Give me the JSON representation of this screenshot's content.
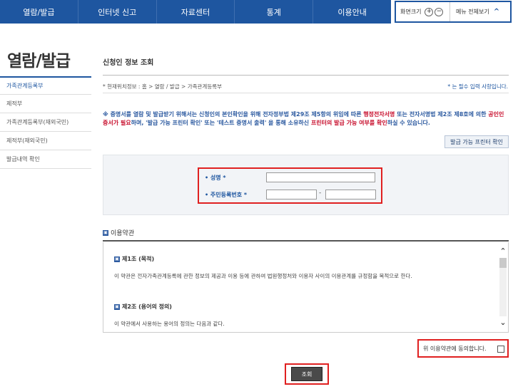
{
  "nav": {
    "items": [
      "열람/발급",
      "인터넷 신고",
      "자료센터",
      "통계",
      "이용안내"
    ],
    "zoom_label": "화면크기",
    "zoom_in": "+",
    "zoom_out": "−",
    "all_menu": "메뉴 전체보기",
    "chevron": "^"
  },
  "sidebar": {
    "title": "열람/발급",
    "items": [
      "가족관계등록부",
      "제적부",
      "가족관계등록부(재외국민)",
      "제적부(재외국민)",
      "발급내역 확인"
    ]
  },
  "main": {
    "title": "신청인 정보 조회",
    "breadcrumb": "* 현재위치정보 : 홈 > 열람 / 발급 > 가족관계등록부",
    "required_note": "* 는 필수 입력 사항입니다.",
    "notice": {
      "p1": "※ 증명서를 열람 및 발급받기 위해서는 신청인의 본인확인을 위해 전자정부법 제29조 제5항의 위임에 따른 ",
      "p2": "행정전자서명",
      "p3": " 또는 전자서명법 제2조 제8호에 의한 ",
      "p4": "공인인증서가 필요",
      "p5": "하며, '발급 가능 프린터 확인' 또는 '테스트 증명서 출력' 을 통해 소유하신 ",
      "p6": "프린터의 발급 가능 여부를 확인",
      "p7": "하실 수 있습니다."
    },
    "printer_button": "발급 가능 프린터 확인",
    "form": {
      "name_label": "• 성명 *",
      "rrn_label": "• 주민등록번호 *",
      "name_value": "",
      "rrn_front": "",
      "rrn_back": "",
      "dash": "-"
    },
    "terms": {
      "title": "이용약관",
      "icon": "▣",
      "article1_title": "제1조 (목적)",
      "article1_body": "이 약관은 전자가족관계등록에 관한 정보의 제공과 이용 등에 관하여 법원행정처와 이용자 사이의 이용관계를 규정함을 목적으로 한다.",
      "article2_title": "제2조 (용어의 정의)",
      "article2_body": "이 약관에서 사용하는 용어의 정의는 다음과 같다.",
      "scroll_up": "⌃",
      "scroll_down": "⌄"
    },
    "agree_label": "위 이용약관에 동의합니다.",
    "submit_label": "조회"
  }
}
